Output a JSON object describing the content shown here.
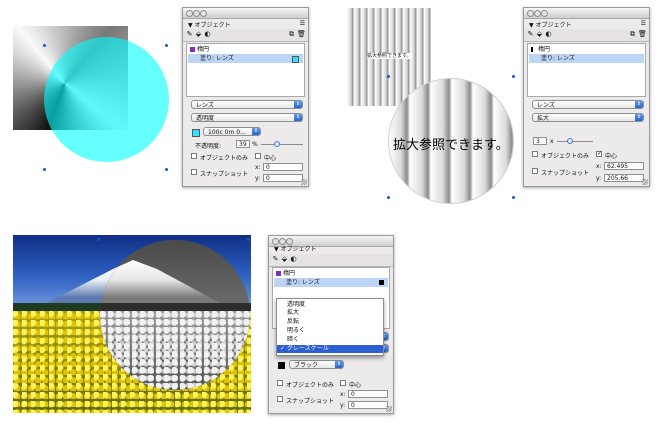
{
  "palette_title": "オブジェクト",
  "menu_icon": "list-menu-icon",
  "panels": {
    "p1": {
      "rows": {
        "circle": "楕円",
        "fill": "塗り: レンズ"
      },
      "lens_type": "レンズ",
      "lens_mode": "透明度",
      "color_value": "100c 0m 0...",
      "opacity_label": "不透明度:",
      "opacity_value": "39",
      "opacity_unit": "%",
      "objects_only": "オブジェクトのみ",
      "center": "中心",
      "snapshot": "スナップショット",
      "x_label": "x:",
      "x_value": "0",
      "y_label": "y:",
      "y_value": "0",
      "opacity_level_pct": 39
    },
    "p2": {
      "rows": {
        "circle": "楕円",
        "fill": "塗り: レンズ"
      },
      "lens_type": "レンズ",
      "lens_mode": "拡大",
      "magnify_value": "3",
      "magnify_unit": "x",
      "objects_only": "オブジェクトのみ",
      "center": "中心",
      "snapshot": "スナップショット",
      "x_label": "x:",
      "x_value": "62.495",
      "y_label": "y:",
      "y_value": "205.66"
    },
    "p3": {
      "rows": {
        "circle": "楕円",
        "fill": "塗り: レンズ"
      },
      "color_value": "ブラック",
      "objects_only": "オブジェクトのみ",
      "center": "中心",
      "snapshot": "スナップショット",
      "x_label": "x:",
      "x_value": "0",
      "y_label": "y:",
      "y_value": "0",
      "menu_items": [
        "透明度",
        "拡大",
        "反転",
        "明るく",
        "暗く",
        "グレースケール"
      ],
      "menu_selected": "グレースケール",
      "checkmark": "✓"
    }
  },
  "canvas2_small_text": "拡大参照できます。",
  "canvas2_big_text": "拡大参照できます。"
}
